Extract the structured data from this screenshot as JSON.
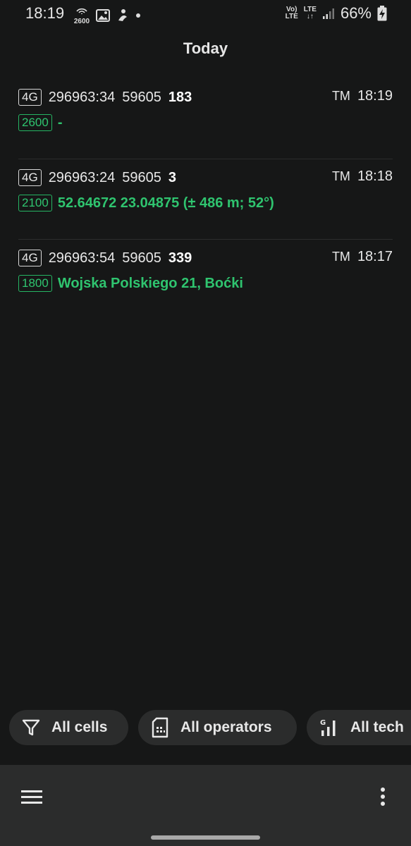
{
  "status_bar": {
    "time": "18:19",
    "band_label": "2600",
    "volte_top": "Vo)",
    "volte_bottom": "LTE",
    "lte_label": "LTE",
    "battery_percent": "66%"
  },
  "title": "Today",
  "entries": [
    {
      "tech": "4G",
      "cell_id": "296963:34",
      "tac": "59605",
      "pci": "183",
      "operator": "TM",
      "time": "18:19",
      "band": "2600",
      "location": "-"
    },
    {
      "tech": "4G",
      "cell_id": "296963:24",
      "tac": "59605",
      "pci": "3",
      "operator": "TM",
      "time": "18:18",
      "band": "2100",
      "location": "52.64672 23.04875 (± 486 m; 52°)"
    },
    {
      "tech": "4G",
      "cell_id": "296963:54",
      "tac": "59605",
      "pci": "339",
      "operator": "TM",
      "time": "18:17",
      "band": "1800",
      "location": "Wojska Polskiego 21, Boćki"
    }
  ],
  "filters": {
    "cells": "All cells",
    "operators": "All operators",
    "tech": "All tech"
  },
  "colors": {
    "background": "#161717",
    "accent_green": "#2fc46f",
    "surface": "#2b2c2c"
  }
}
